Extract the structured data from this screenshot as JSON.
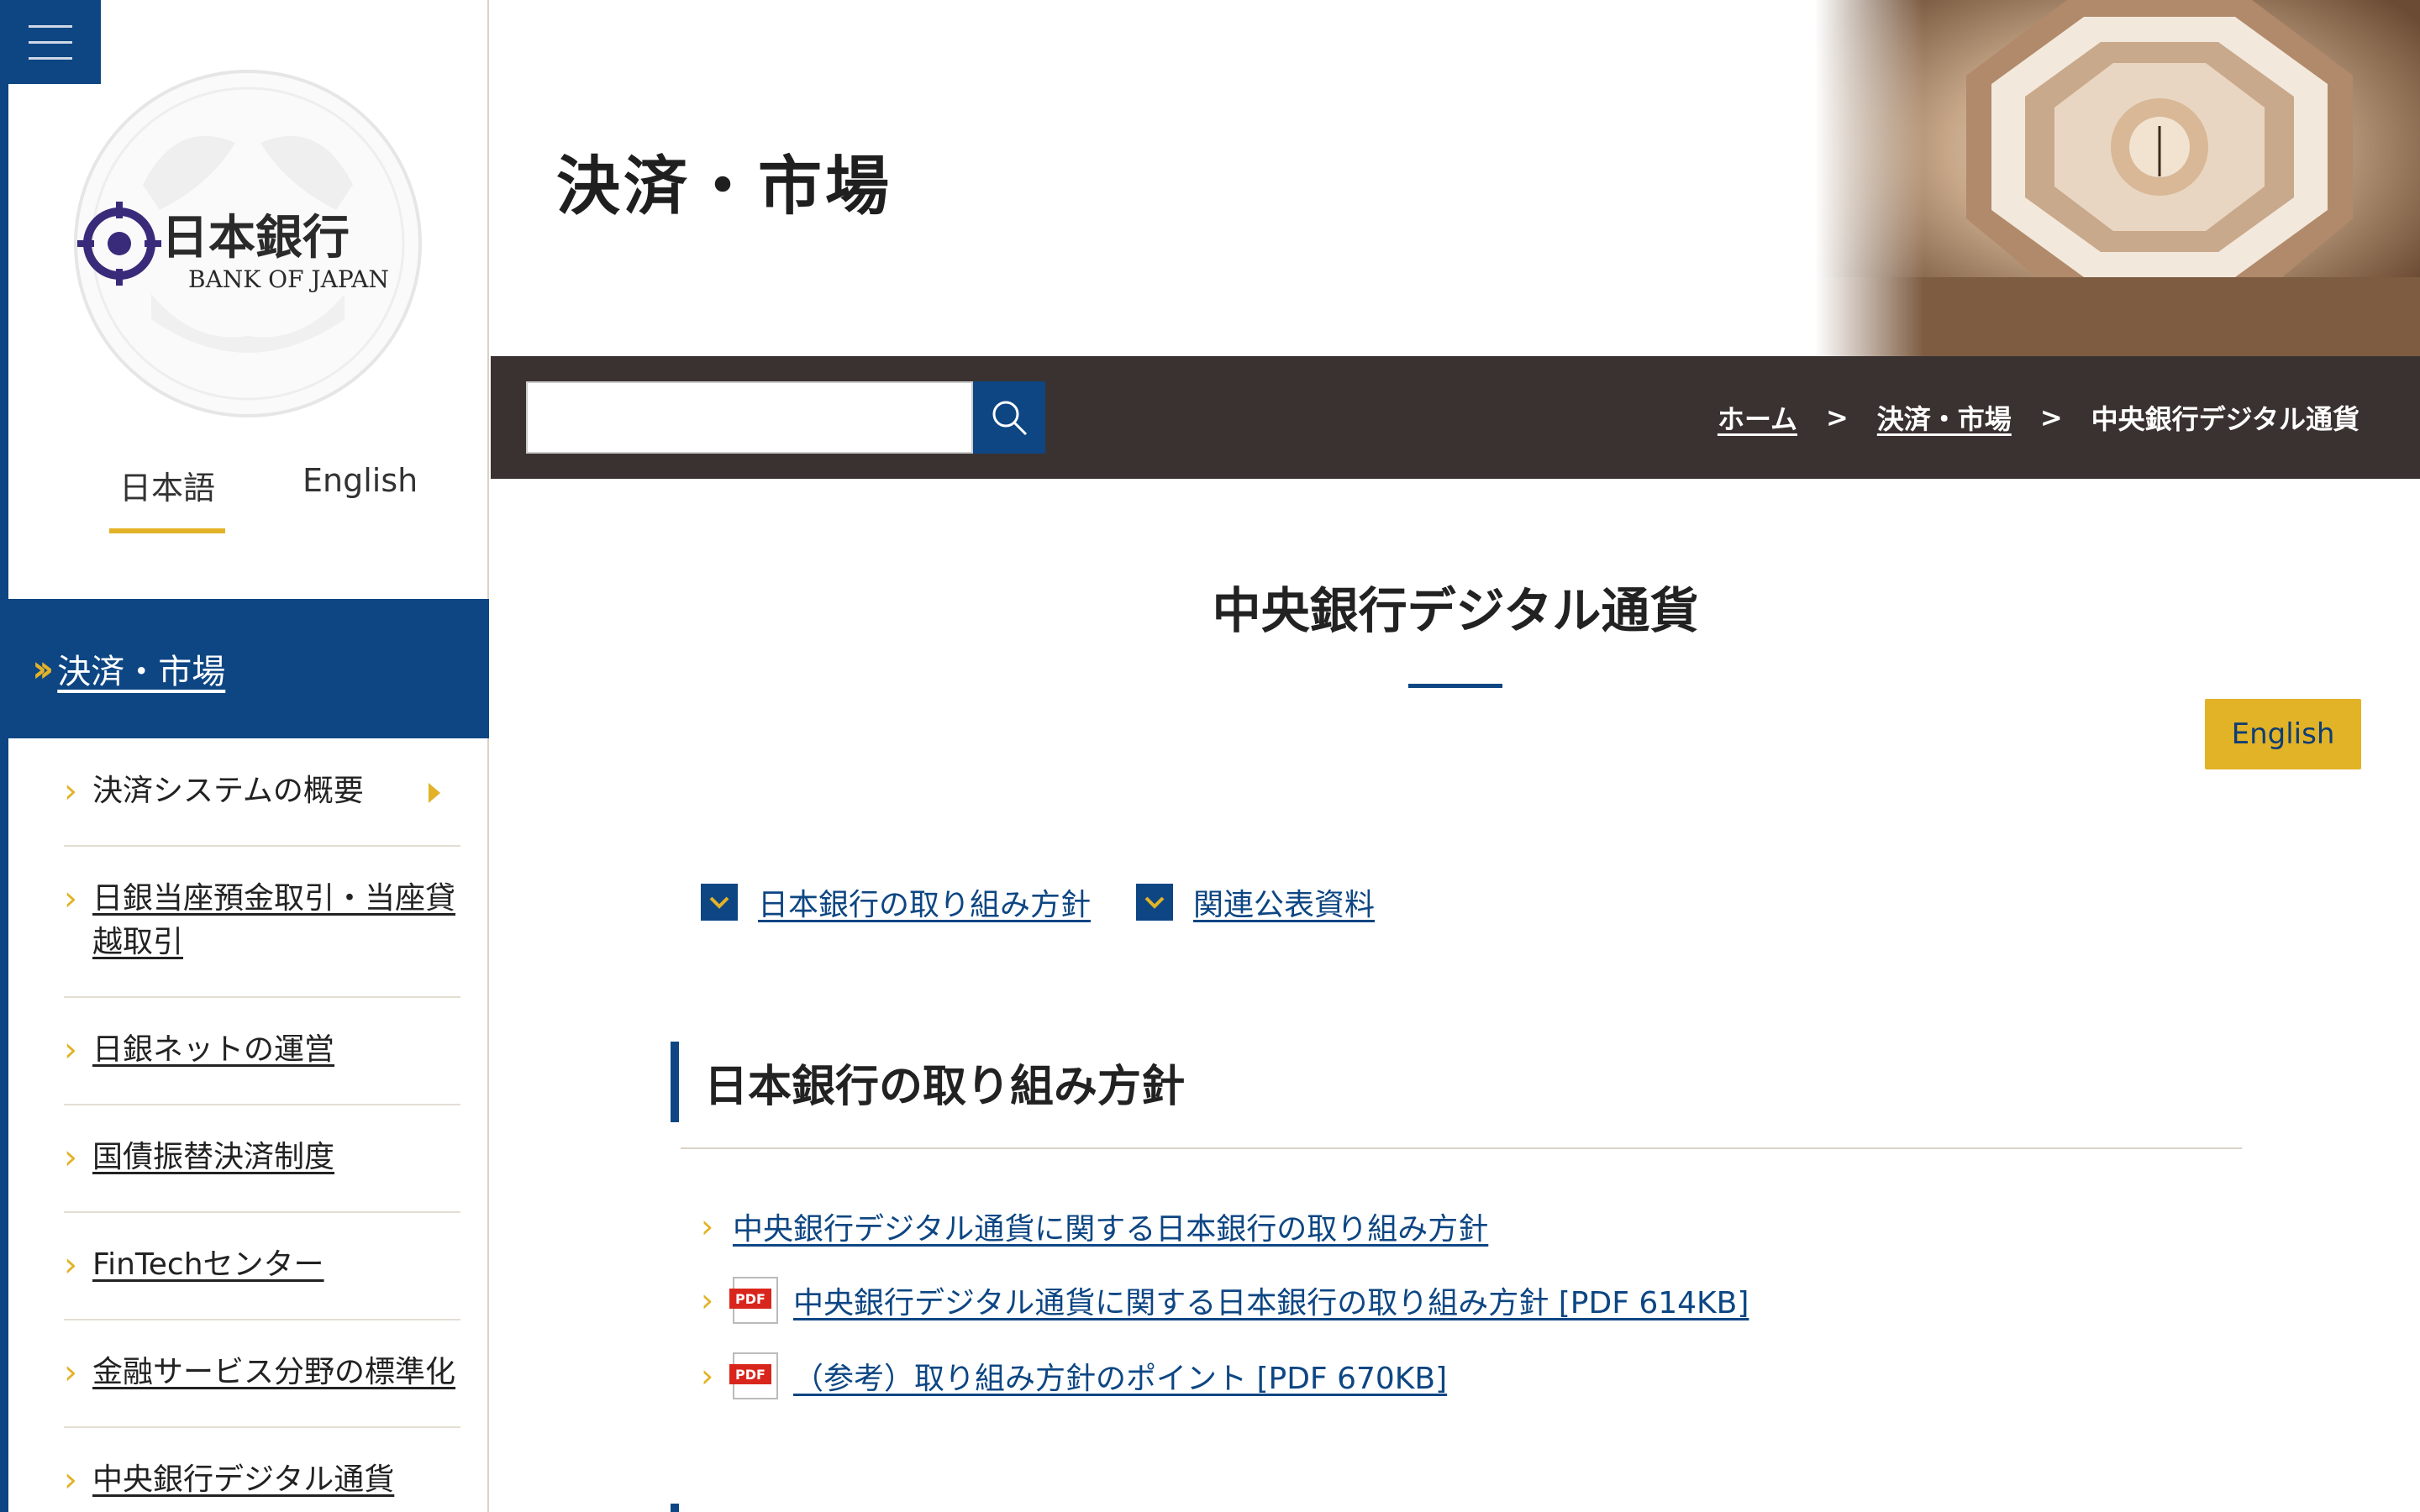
{
  "sidebar": {
    "logo_text_jp": "日本銀行",
    "logo_text_en": "BANK OF JAPAN",
    "lang_tabs": [
      {
        "label": "日本語",
        "active": true
      },
      {
        "label": "English",
        "active": false
      }
    ],
    "current_section": "決済・市場",
    "items": [
      {
        "label": "決済システムの概要"
      },
      {
        "label": "日銀当座預金取引・当座貸越取引"
      },
      {
        "label": "日銀ネットの運営"
      },
      {
        "label": "国債振替決済制度"
      },
      {
        "label": "FinTechセンター"
      },
      {
        "label": "金融サービス分野の標準化"
      },
      {
        "label": "中央銀行デジタル通貨"
      }
    ]
  },
  "header": {
    "title": "決済・市場"
  },
  "search": {
    "value": "",
    "button_icon": "search-icon"
  },
  "breadcrumb": {
    "items": [
      "ホーム",
      "決済・市場",
      "中央銀行デジタル通貨"
    ],
    "separator": ">"
  },
  "main": {
    "title": "中央銀行デジタル通貨",
    "english_button": "English",
    "anchors": [
      {
        "label": "日本銀行の取り組み方針"
      },
      {
        "label": "関連公表資料"
      }
    ],
    "section_title": "日本銀行の取り組み方針",
    "links": [
      {
        "label": "中央銀行デジタル通貨に関する日本銀行の取り組み方針",
        "pdf": false
      },
      {
        "label": "中央銀行デジタル通貨に関する日本銀行の取り組み方針 [PDF 614KB]",
        "pdf": true
      },
      {
        "label": "（参考）取り組み方針のポイント [PDF 670KB]",
        "pdf": true
      }
    ],
    "pdf_badge": "PDF"
  },
  "colors": {
    "brand_blue": "#0d4683",
    "accent_gold": "#e2b227",
    "dark_bar": "#3a3230",
    "pdf_red": "#d9261c"
  }
}
